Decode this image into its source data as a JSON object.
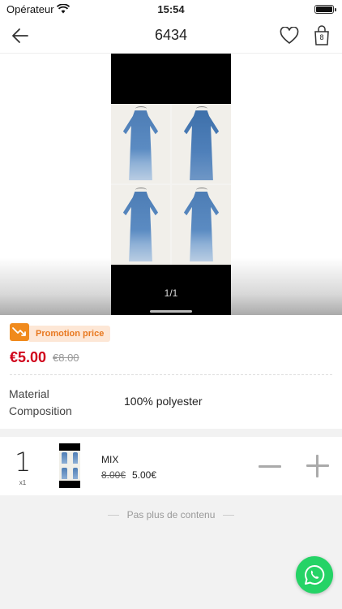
{
  "status_bar": {
    "carrier": "Opérateur",
    "time": "15:54"
  },
  "nav": {
    "title": "6434",
    "bag_count": "8"
  },
  "gallery": {
    "counter": "1/1"
  },
  "promo": {
    "badge": "Promotion price",
    "price_now": "€5.00",
    "price_old": "€8.00"
  },
  "material": {
    "label": "Material Composition",
    "value": "100% polyester"
  },
  "variant": {
    "quantity": "1",
    "multiplier": "x1",
    "name": "MIX",
    "old_price": "8.00€",
    "new_price": "5.00€"
  },
  "footer": {
    "no_more": "Pas plus de contenu"
  },
  "colors": {
    "accent": "#d0021b",
    "promo": "#f08a1c",
    "whatsapp": "#25d366"
  }
}
